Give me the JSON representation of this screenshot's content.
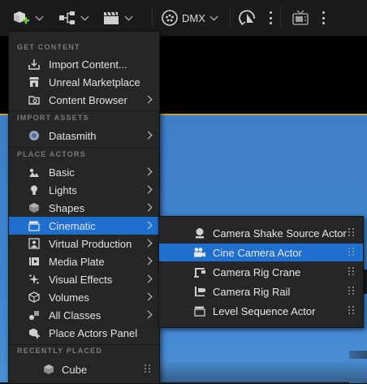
{
  "toolbar": {
    "dmx_label": "DMX"
  },
  "menu": {
    "sections": {
      "get_content": "GET CONTENT",
      "import_assets": "IMPORT ASSETS",
      "place_actors": "PLACE ACTORS",
      "recently_placed": "RECENTLY PLACED"
    },
    "items": [
      {
        "label": "Import Content...",
        "icon": "import-icon",
        "submenu": false
      },
      {
        "label": "Unreal Marketplace",
        "icon": "marketplace-icon",
        "submenu": false
      },
      {
        "label": "Content Browser",
        "icon": "content-browser-icon",
        "submenu": true
      },
      {
        "label": "Datasmith",
        "icon": "datasmith-icon",
        "submenu": true
      },
      {
        "label": "Basic",
        "icon": "basic-icon",
        "submenu": true
      },
      {
        "label": "Lights",
        "icon": "light-icon",
        "submenu": true
      },
      {
        "label": "Shapes",
        "icon": "shapes-icon",
        "submenu": true
      },
      {
        "label": "Cinematic",
        "icon": "cinematic-icon",
        "submenu": true,
        "active": true
      },
      {
        "label": "Virtual Production",
        "icon": "virtual-production-icon",
        "submenu": true
      },
      {
        "label": "Media Plate",
        "icon": "media-plate-icon",
        "submenu": true
      },
      {
        "label": "Visual Effects",
        "icon": "visual-effects-icon",
        "submenu": true
      },
      {
        "label": "Volumes",
        "icon": "volumes-icon",
        "submenu": true
      },
      {
        "label": "All Classes",
        "icon": "all-classes-icon",
        "submenu": true
      },
      {
        "label": "Place Actors Panel",
        "icon": "place-actors-icon",
        "submenu": false
      }
    ],
    "recent": [
      {
        "label": "Cube",
        "icon": "cube-icon"
      }
    ]
  },
  "submenu": {
    "items": [
      {
        "label": "Camera Shake Source Actor",
        "icon": "camera-shake-icon"
      },
      {
        "label": "Cine Camera Actor",
        "icon": "cine-camera-icon",
        "active": true
      },
      {
        "label": "Camera Rig Crane",
        "icon": "camera-crane-icon"
      },
      {
        "label": "Camera Rig Rail",
        "icon": "camera-rail-icon"
      },
      {
        "label": "Level Sequence Actor",
        "icon": "level-sequence-icon"
      }
    ]
  },
  "colors": {
    "menu_bg": "#262626",
    "active": "#1e6fce",
    "accent_green": "#6dc94a",
    "viewport_sky": "#3f84cf"
  }
}
